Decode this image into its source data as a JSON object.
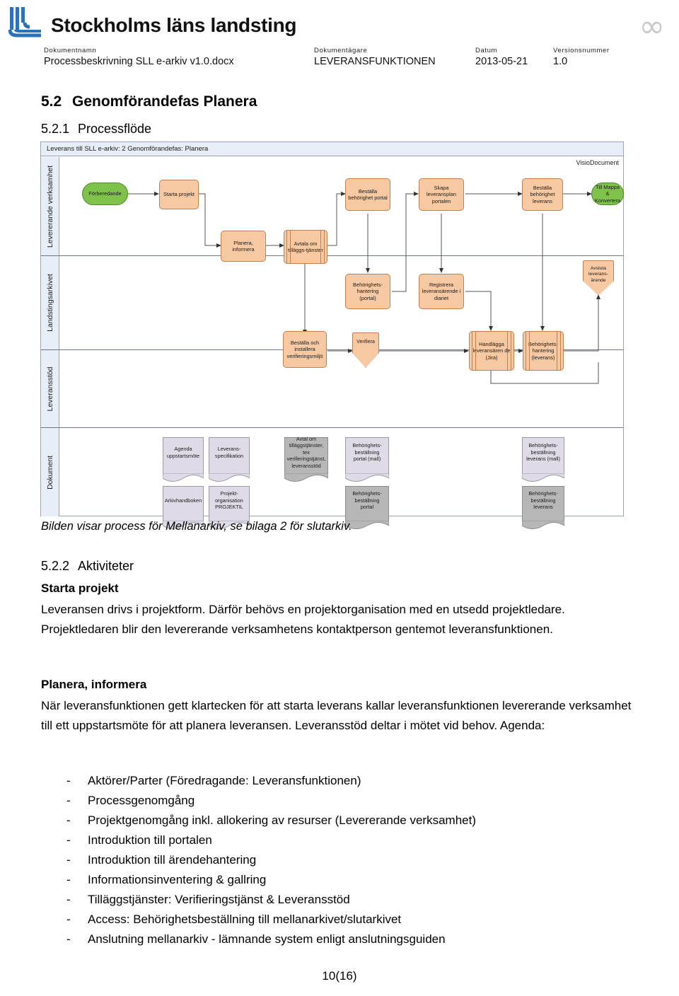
{
  "header": {
    "org_name": "Stockholms läns landsting",
    "logo_icon": "sll-logo-icon",
    "infinity_icon": "infinity-icon",
    "labels": {
      "dokumentnamn": "Dokumentnamn",
      "dokumentagare": "Dokumentägare",
      "datum": "Datum",
      "versionsnummer": "Versionsnummer"
    },
    "values": {
      "dokumentnamn": "Processbeskrivning SLL e-arkiv v1.0.docx",
      "dokumentagare": "LEVERANSFUNKTIONEN",
      "datum": "2013-05-21",
      "versionsnummer": "1.0"
    }
  },
  "headings": {
    "h2_num": "5.2",
    "h2_text": "Genomförandefas Planera",
    "h3_num": "5.2.1",
    "h3_text": "Processflöde",
    "h3b_num": "5.2.2",
    "h3b_text": "Aktiviteter"
  },
  "diagram": {
    "title": "Leverans till SLL e-arkiv: 2 Genomförandefas: Planera",
    "source_tag": "VisioDocument",
    "lanes": [
      {
        "label": "Levererande verksamhet"
      },
      {
        "label": "Landstingsarkivet"
      },
      {
        "label": "Leveransstöd"
      },
      {
        "label": "Dokument"
      }
    ],
    "nodes": {
      "forberedande": "Förberedande",
      "starta_projekt": "Starta projekt",
      "planera_informera": "Planera, informera",
      "avtala_tillaggstjanster": "Avtala om tilläggs-tjänster",
      "bestalla_behorighet_portal": "Beställa behörighet portal",
      "skapa_leveransplan": "Skapa leveransplan portalen",
      "bestalla_behorighet_leverans": "Beställa behörighet leverans",
      "till_mappa_konvertera": "Till Mappa & Konvertera",
      "behorighetshantering_portal": "Behörighets-hantering (portal)",
      "registrera_leveransarende": "Registrera leveransärende i diariet",
      "bestalla_installera_verifieringsmiljo": "Beställa och installera verifieringsmiljö",
      "verifiera": "Verifiera",
      "handlagga_leveransarende": "Handlägga leveransären de (Jira)",
      "behorighetshantering_leverans": "Behörighets-hantering (leverans)",
      "avsluta_leveransarende": "Avsluta leverans-ärende"
    },
    "documents": [
      {
        "label": "Agenda uppstartsmöte",
        "dark": false
      },
      {
        "label": "Leverans-specifikation",
        "dark": false
      },
      {
        "label": "Avtal om tilläggstjänster, tex verifieringstjänst, leveransstöd",
        "dark": true
      },
      {
        "label": "Behörighets-beställning portal (mall)",
        "dark": false
      },
      {
        "label": "Behörighets-beställning leverans (mall)",
        "dark": false
      },
      {
        "label": "Arkivhandboken",
        "dark": false
      },
      {
        "label": "Projekt-organisation PROJEKTIL",
        "dark": false
      },
      {
        "label": "Behörighets-beställning portal",
        "dark": true
      },
      {
        "label": "Behörighets-beställning leverans",
        "dark": true
      }
    ],
    "colors": {
      "task_fill": "#f7c9a2",
      "task_stroke": "#c08050",
      "terminator_fill": "#7fc24b",
      "terminator_stroke": "#4f8a29",
      "document_fill": "#dedbe6",
      "document_fill_dark": "#b7b7b7",
      "lane_header_fill": "#e8eef7"
    }
  },
  "body": {
    "caption": "Bilden visar process för Mellanarkiv, se bilaga 2 för slutarkiv.",
    "section_starta_projekt": {
      "heading": "Starta projekt",
      "text": "Leveransen drivs i projektform. Därför behövs en projektorganisation med en utsedd projektledare. Projektledaren blir den levererande verksamhetens kontaktperson gentemot leveransfunktionen."
    },
    "section_planera_informera": {
      "heading": "Planera, informera",
      "text": "När leveransfunktionen gett klartecken för att starta leverans kallar leveransfunktionen levererande verksamhet till ett uppstartsmöte för att planera leveransen. Leveransstöd deltar i mötet vid behov. Agenda:"
    },
    "agenda_items": [
      "Aktörer/Parter (Föredragande: Leveransfunktionen)",
      "Processgenomgång",
      "Projektgenomgång inkl. allokering av resurser (Levererande verksamhet)",
      "Introduktion till portalen",
      "Introduktion till ärendehantering",
      "Informationsinventering & gallring",
      "Tilläggstjänster: Verifieringstjänst & Leveransstöd",
      "Access: Behörighetsbeställning till mellanarkivet/slutarkivet",
      "Anslutning mellanarkiv - lämnande system enligt anslutningsguiden"
    ]
  },
  "footer": {
    "page_number": "10(16)"
  }
}
